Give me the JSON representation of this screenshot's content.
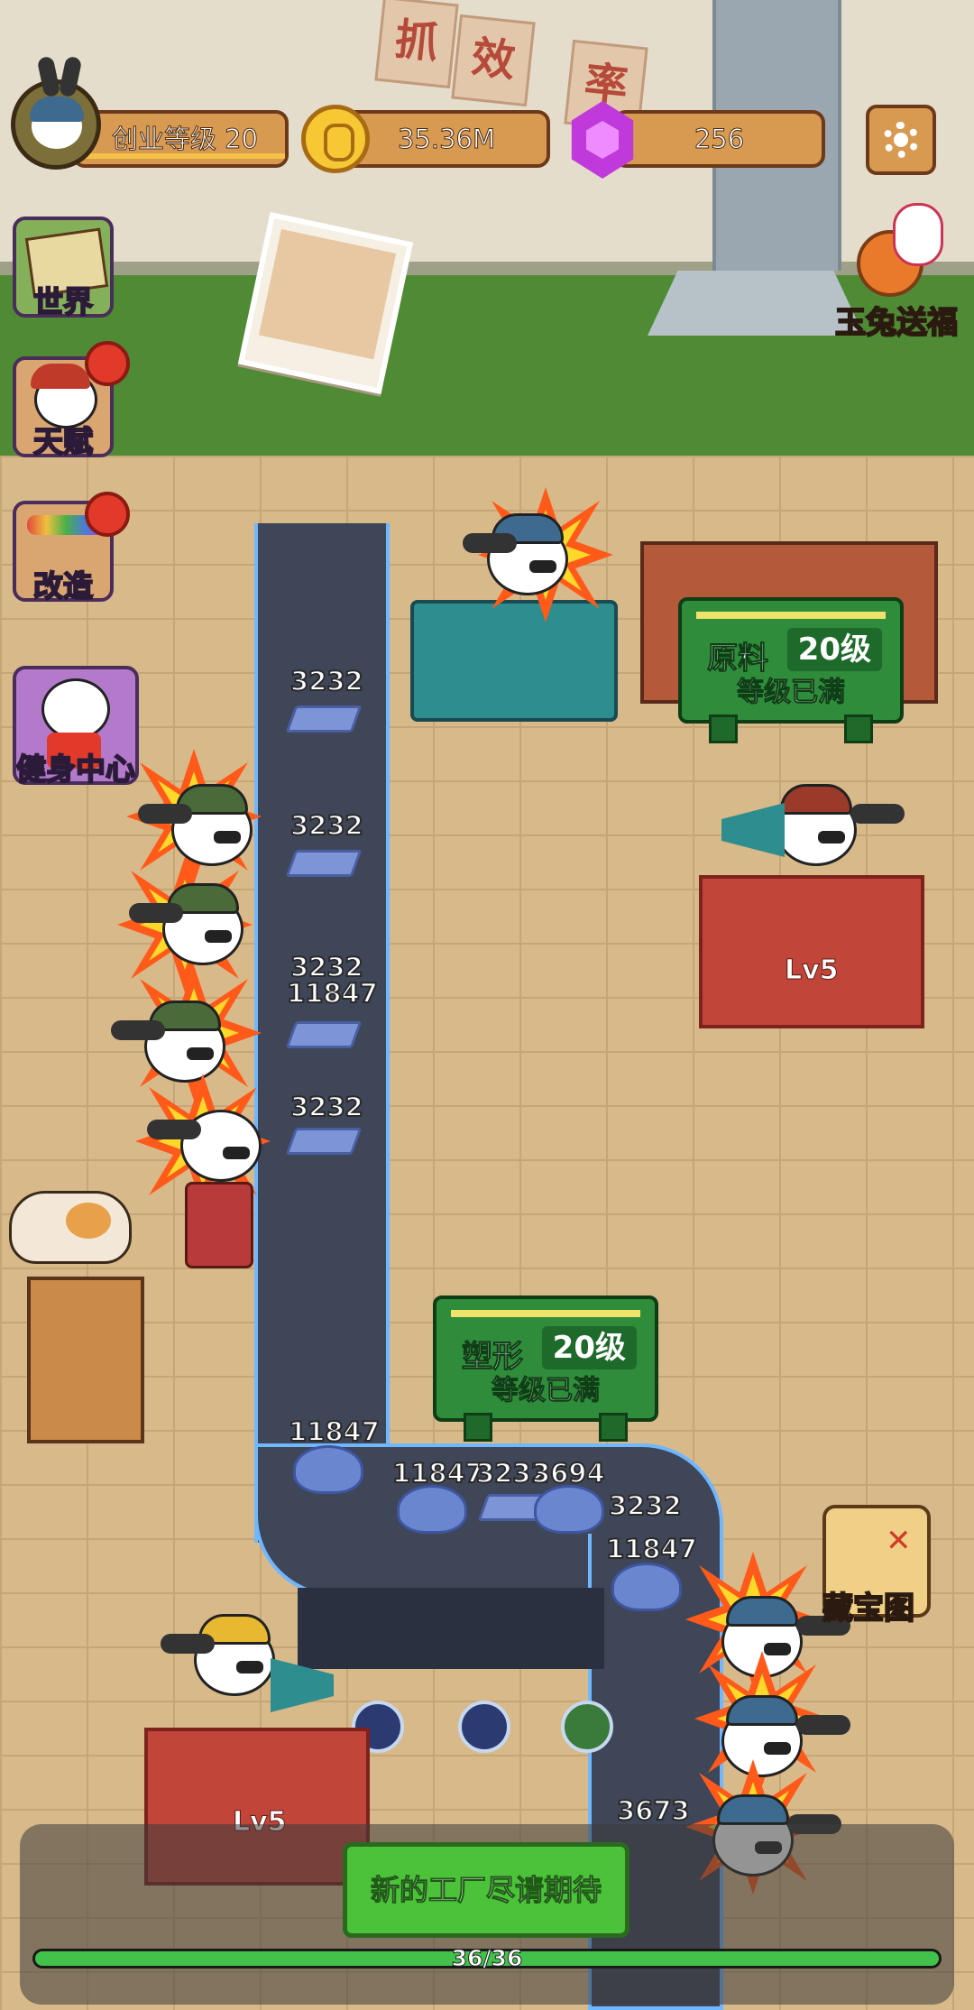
{
  "banner_chars": [
    "抓",
    "效",
    "率",
    "·"
  ],
  "hud": {
    "level_label": "创业等级 20",
    "gold_value": "35.36M",
    "gem_value": "256"
  },
  "side_menu": {
    "world": "世界",
    "talent": "天赋",
    "reform": "改造",
    "gym": "健身中心"
  },
  "right_menu": {
    "yutu": "玉兔送福",
    "treasure_map": "藏宝图"
  },
  "signs": {
    "raw": {
      "name": "原料",
      "level": "20级",
      "status": "等级已满"
    },
    "shape": {
      "name": "塑形",
      "level": "20级",
      "status": "等级已满"
    }
  },
  "stations": {
    "top_right_level": "Lv5",
    "bottom_left_level": "Lv5"
  },
  "belt_numbers": {
    "n1": "3232",
    "n2": "3232",
    "n3": "3232",
    "n4": "11847",
    "n5": "3232",
    "n6": "3232",
    "n7": "11847",
    "n8": "11847",
    "n9": "3232",
    "n10": "3694",
    "n11": "3232",
    "n12": "11847",
    "n13": "3673"
  },
  "bottom": {
    "new_factory": "新的工厂尽请期待",
    "progress_text": "36/36",
    "progress_current": 36,
    "progress_max": 36
  },
  "colors": {
    "belt_glow": "#6fb7ff",
    "sign_green": "#2f8c3b",
    "progress_green": "#42c24a"
  }
}
